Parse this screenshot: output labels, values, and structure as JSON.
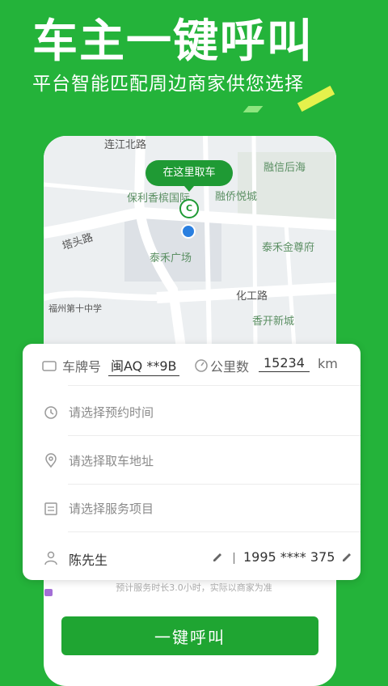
{
  "hero": {
    "title": "车主一键呼叫",
    "subtitle": "平台智能匹配周边商家供您选择"
  },
  "map": {
    "pickup_bubble": "在这里取车",
    "pin_text": "C",
    "labels": [
      "连江北路",
      "融信后海",
      "保利香槟国际",
      "融侨悦城",
      "塔头路",
      "泰禾广场",
      "泰禾金尊府",
      "福州第十中学",
      "化工路",
      "香开新城"
    ]
  },
  "form": {
    "plate_label": "车牌号",
    "plate_value": "闽AQ **9B",
    "mileage_label": "公里数",
    "mileage_value": "15234",
    "mileage_unit": "km",
    "time_placeholder": "请选择预约时间",
    "address_placeholder": "请选择取车地址",
    "service_placeholder": "请选择服务项目",
    "contact_name": "陈先生",
    "contact_phone": "1995 **** 375"
  },
  "estimate_note": "预计服务时长3.0小时，实际以商家为准",
  "cta_label": "一键呼叫",
  "colors": {
    "brand_green": "#24b33a",
    "button_green": "#1fa532"
  }
}
